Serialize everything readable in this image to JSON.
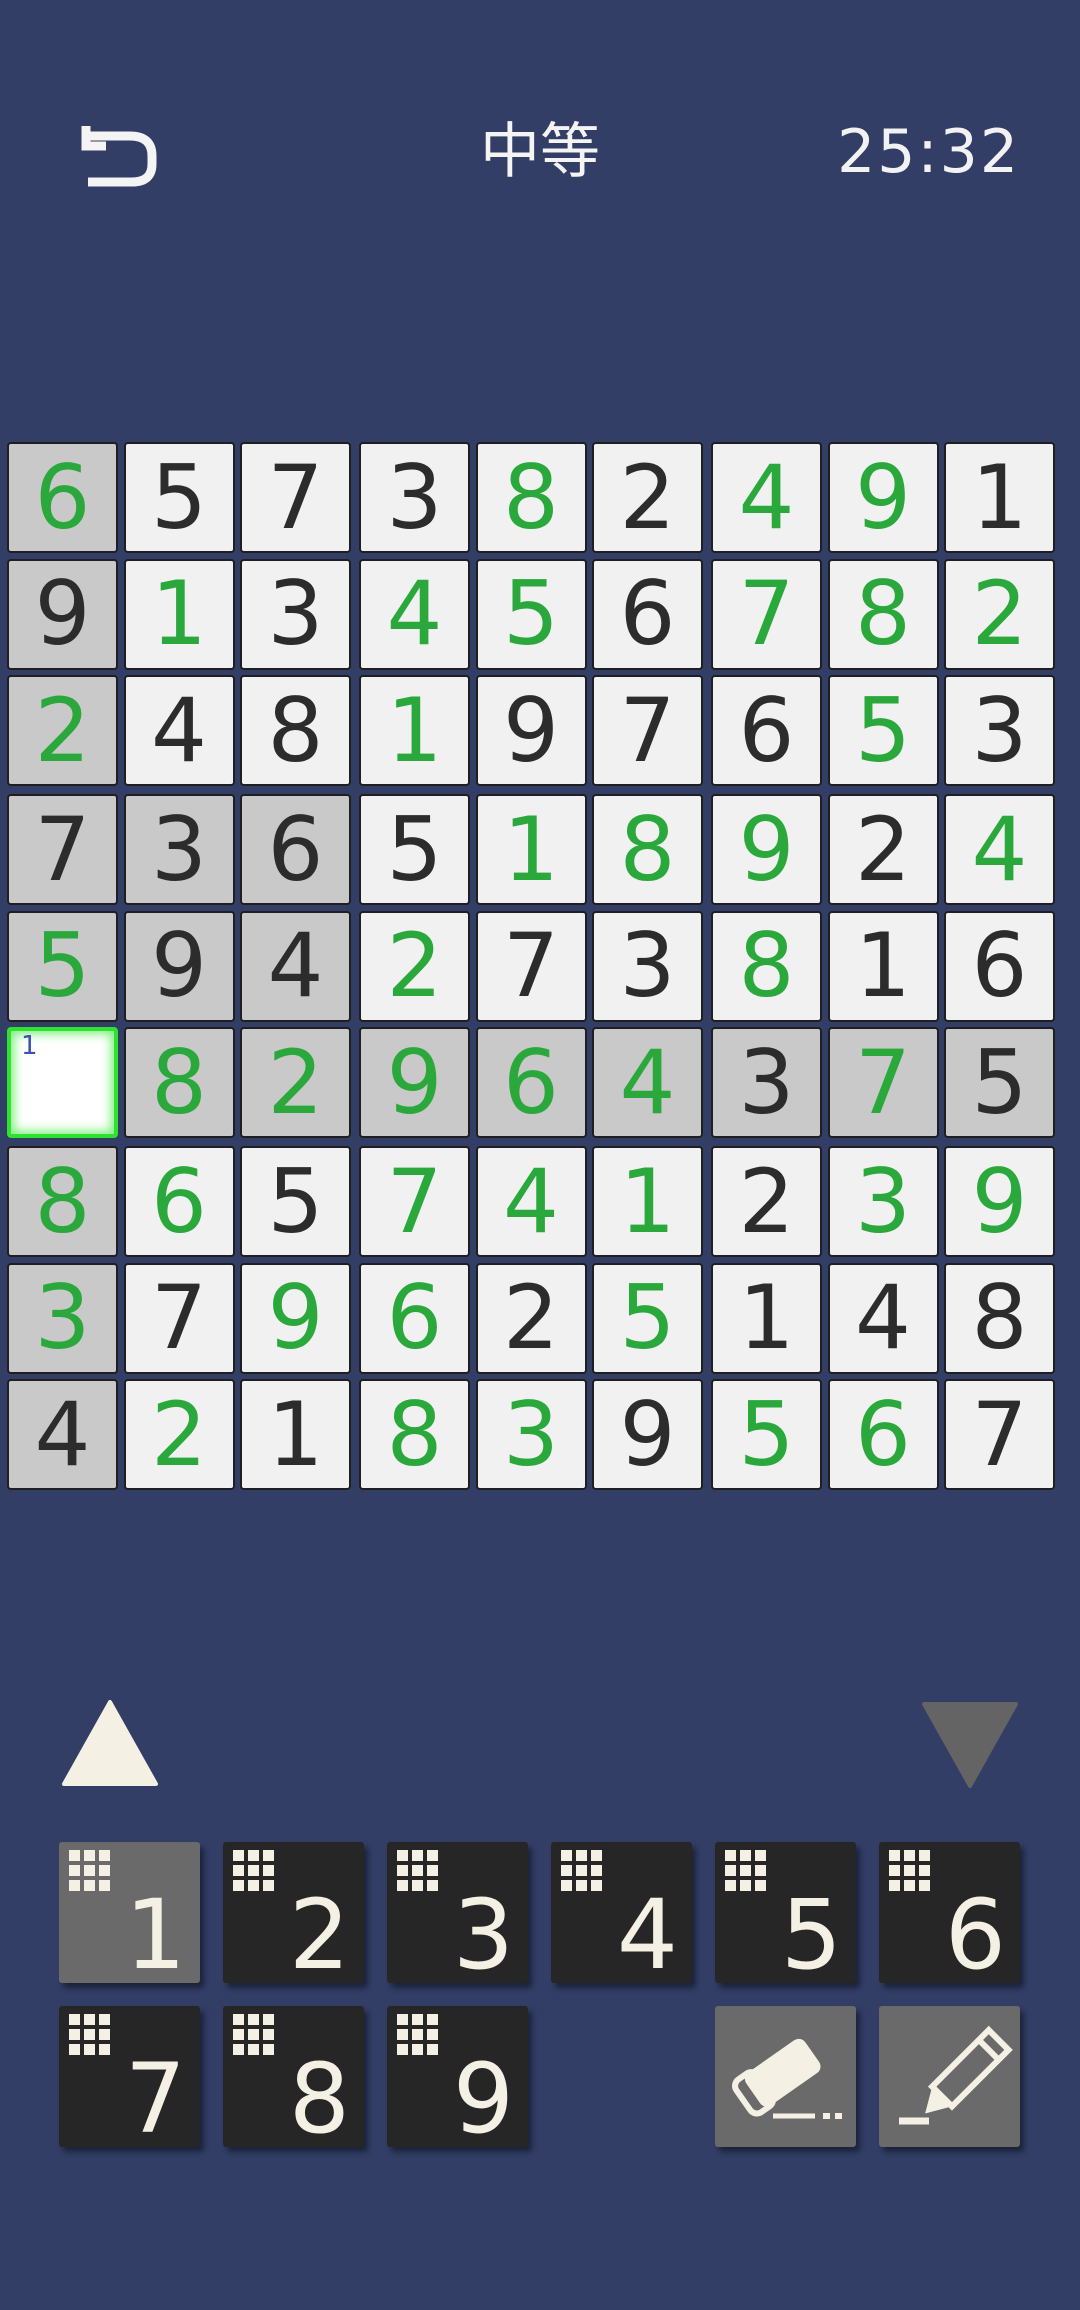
{
  "header": {
    "title": "中等",
    "timer": "25:32"
  },
  "icons": {
    "back": "back-arrow-icon",
    "arrow_up": "triangle-up-icon",
    "arrow_down": "triangle-down-icon",
    "eraser": "eraser-icon",
    "pencil": "pencil-icon",
    "notes_grid": "notes-grid-icon"
  },
  "colors": {
    "background": "#323e66",
    "cell": "#f1f1f1",
    "highlight": "#c9c9c9",
    "user_digit": "#2ba83b",
    "given_digit": "#2c2c2c",
    "selected_border": "#2ee22e",
    "note": "#3a4fb8"
  },
  "board": {
    "grid": [
      [
        "6",
        "5",
        "7",
        "3",
        "8",
        "2",
        "4",
        "9",
        "1"
      ],
      [
        "9",
        "1",
        "3",
        "4",
        "5",
        "6",
        "7",
        "8",
        "2"
      ],
      [
        "2",
        "4",
        "8",
        "1",
        "9",
        "7",
        "6",
        "5",
        "3"
      ],
      [
        "7",
        "3",
        "6",
        "5",
        "1",
        "8",
        "9",
        "2",
        "4"
      ],
      [
        "5",
        "9",
        "4",
        "2",
        "7",
        "3",
        "8",
        "1",
        "6"
      ],
      [
        "",
        "8",
        "2",
        "9",
        "6",
        "4",
        "3",
        "7",
        "5"
      ],
      [
        "8",
        "6",
        "5",
        "7",
        "4",
        "1",
        "2",
        "3",
        "9"
      ],
      [
        "3",
        "7",
        "9",
        "6",
        "2",
        "5",
        "1",
        "4",
        "8"
      ],
      [
        "4",
        "2",
        "1",
        "8",
        "3",
        "9",
        "5",
        "6",
        "7"
      ]
    ],
    "kinds": [
      [
        "u",
        "g",
        "g",
        "g",
        "u",
        "g",
        "u",
        "u",
        "g"
      ],
      [
        "g",
        "u",
        "g",
        "u",
        "u",
        "g",
        "u",
        "u",
        "u"
      ],
      [
        "u",
        "g",
        "g",
        "u",
        "g",
        "g",
        "g",
        "u",
        "g"
      ],
      [
        "g",
        "g",
        "g",
        "g",
        "u",
        "u",
        "u",
        "g",
        "u"
      ],
      [
        "u",
        "g",
        "g",
        "u",
        "g",
        "g",
        "u",
        "g",
        "g"
      ],
      [
        "s",
        "u",
        "u",
        "u",
        "u",
        "u",
        "g",
        "u",
        "g"
      ],
      [
        "u",
        "u",
        "g",
        "u",
        "u",
        "u",
        "g",
        "u",
        "u"
      ],
      [
        "u",
        "g",
        "u",
        "u",
        "g",
        "u",
        "g",
        "g",
        "g"
      ],
      [
        "g",
        "u",
        "g",
        "u",
        "u",
        "g",
        "u",
        "u",
        "g"
      ]
    ],
    "selected": {
      "row": 5,
      "col": 0
    },
    "selected_note": "1"
  },
  "numpad": {
    "digits": [
      "1",
      "2",
      "3",
      "4",
      "5",
      "6",
      "7",
      "8",
      "9"
    ],
    "active": "1"
  }
}
